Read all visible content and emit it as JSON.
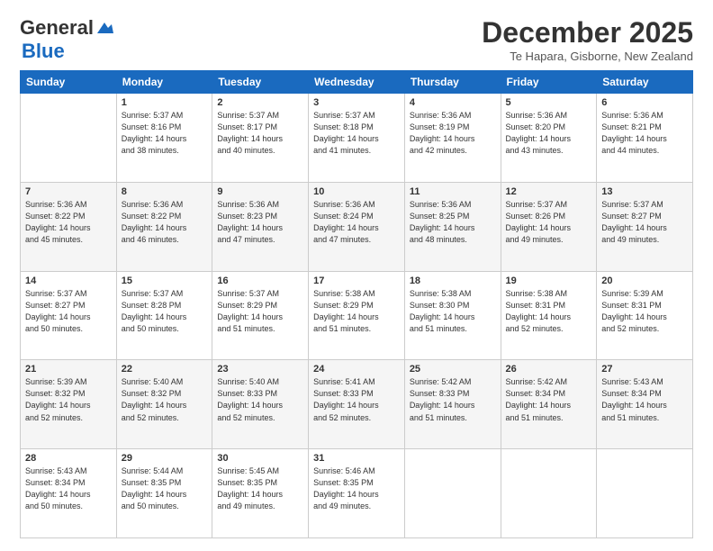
{
  "logo": {
    "general": "General",
    "blue": "Blue"
  },
  "title": "December 2025",
  "subtitle": "Te Hapara, Gisborne, New Zealand",
  "days": [
    "Sunday",
    "Monday",
    "Tuesday",
    "Wednesday",
    "Thursday",
    "Friday",
    "Saturday"
  ],
  "weeks": [
    [
      {
        "day": "",
        "info": ""
      },
      {
        "day": "1",
        "info": "Sunrise: 5:37 AM\nSunset: 8:16 PM\nDaylight: 14 hours\nand 38 minutes."
      },
      {
        "day": "2",
        "info": "Sunrise: 5:37 AM\nSunset: 8:17 PM\nDaylight: 14 hours\nand 40 minutes."
      },
      {
        "day": "3",
        "info": "Sunrise: 5:37 AM\nSunset: 8:18 PM\nDaylight: 14 hours\nand 41 minutes."
      },
      {
        "day": "4",
        "info": "Sunrise: 5:36 AM\nSunset: 8:19 PM\nDaylight: 14 hours\nand 42 minutes."
      },
      {
        "day": "5",
        "info": "Sunrise: 5:36 AM\nSunset: 8:20 PM\nDaylight: 14 hours\nand 43 minutes."
      },
      {
        "day": "6",
        "info": "Sunrise: 5:36 AM\nSunset: 8:21 PM\nDaylight: 14 hours\nand 44 minutes."
      }
    ],
    [
      {
        "day": "7",
        "info": "Sunrise: 5:36 AM\nSunset: 8:22 PM\nDaylight: 14 hours\nand 45 minutes."
      },
      {
        "day": "8",
        "info": "Sunrise: 5:36 AM\nSunset: 8:22 PM\nDaylight: 14 hours\nand 46 minutes."
      },
      {
        "day": "9",
        "info": "Sunrise: 5:36 AM\nSunset: 8:23 PM\nDaylight: 14 hours\nand 47 minutes."
      },
      {
        "day": "10",
        "info": "Sunrise: 5:36 AM\nSunset: 8:24 PM\nDaylight: 14 hours\nand 47 minutes."
      },
      {
        "day": "11",
        "info": "Sunrise: 5:36 AM\nSunset: 8:25 PM\nDaylight: 14 hours\nand 48 minutes."
      },
      {
        "day": "12",
        "info": "Sunrise: 5:37 AM\nSunset: 8:26 PM\nDaylight: 14 hours\nand 49 minutes."
      },
      {
        "day": "13",
        "info": "Sunrise: 5:37 AM\nSunset: 8:27 PM\nDaylight: 14 hours\nand 49 minutes."
      }
    ],
    [
      {
        "day": "14",
        "info": "Sunrise: 5:37 AM\nSunset: 8:27 PM\nDaylight: 14 hours\nand 50 minutes."
      },
      {
        "day": "15",
        "info": "Sunrise: 5:37 AM\nSunset: 8:28 PM\nDaylight: 14 hours\nand 50 minutes."
      },
      {
        "day": "16",
        "info": "Sunrise: 5:37 AM\nSunset: 8:29 PM\nDaylight: 14 hours\nand 51 minutes."
      },
      {
        "day": "17",
        "info": "Sunrise: 5:38 AM\nSunset: 8:29 PM\nDaylight: 14 hours\nand 51 minutes."
      },
      {
        "day": "18",
        "info": "Sunrise: 5:38 AM\nSunset: 8:30 PM\nDaylight: 14 hours\nand 51 minutes."
      },
      {
        "day": "19",
        "info": "Sunrise: 5:38 AM\nSunset: 8:31 PM\nDaylight: 14 hours\nand 52 minutes."
      },
      {
        "day": "20",
        "info": "Sunrise: 5:39 AM\nSunset: 8:31 PM\nDaylight: 14 hours\nand 52 minutes."
      }
    ],
    [
      {
        "day": "21",
        "info": "Sunrise: 5:39 AM\nSunset: 8:32 PM\nDaylight: 14 hours\nand 52 minutes."
      },
      {
        "day": "22",
        "info": "Sunrise: 5:40 AM\nSunset: 8:32 PM\nDaylight: 14 hours\nand 52 minutes."
      },
      {
        "day": "23",
        "info": "Sunrise: 5:40 AM\nSunset: 8:33 PM\nDaylight: 14 hours\nand 52 minutes."
      },
      {
        "day": "24",
        "info": "Sunrise: 5:41 AM\nSunset: 8:33 PM\nDaylight: 14 hours\nand 52 minutes."
      },
      {
        "day": "25",
        "info": "Sunrise: 5:42 AM\nSunset: 8:33 PM\nDaylight: 14 hours\nand 51 minutes."
      },
      {
        "day": "26",
        "info": "Sunrise: 5:42 AM\nSunset: 8:34 PM\nDaylight: 14 hours\nand 51 minutes."
      },
      {
        "day": "27",
        "info": "Sunrise: 5:43 AM\nSunset: 8:34 PM\nDaylight: 14 hours\nand 51 minutes."
      }
    ],
    [
      {
        "day": "28",
        "info": "Sunrise: 5:43 AM\nSunset: 8:34 PM\nDaylight: 14 hours\nand 50 minutes."
      },
      {
        "day": "29",
        "info": "Sunrise: 5:44 AM\nSunset: 8:35 PM\nDaylight: 14 hours\nand 50 minutes."
      },
      {
        "day": "30",
        "info": "Sunrise: 5:45 AM\nSunset: 8:35 PM\nDaylight: 14 hours\nand 49 minutes."
      },
      {
        "day": "31",
        "info": "Sunrise: 5:46 AM\nSunset: 8:35 PM\nDaylight: 14 hours\nand 49 minutes."
      },
      {
        "day": "",
        "info": ""
      },
      {
        "day": "",
        "info": ""
      },
      {
        "day": "",
        "info": ""
      }
    ]
  ]
}
